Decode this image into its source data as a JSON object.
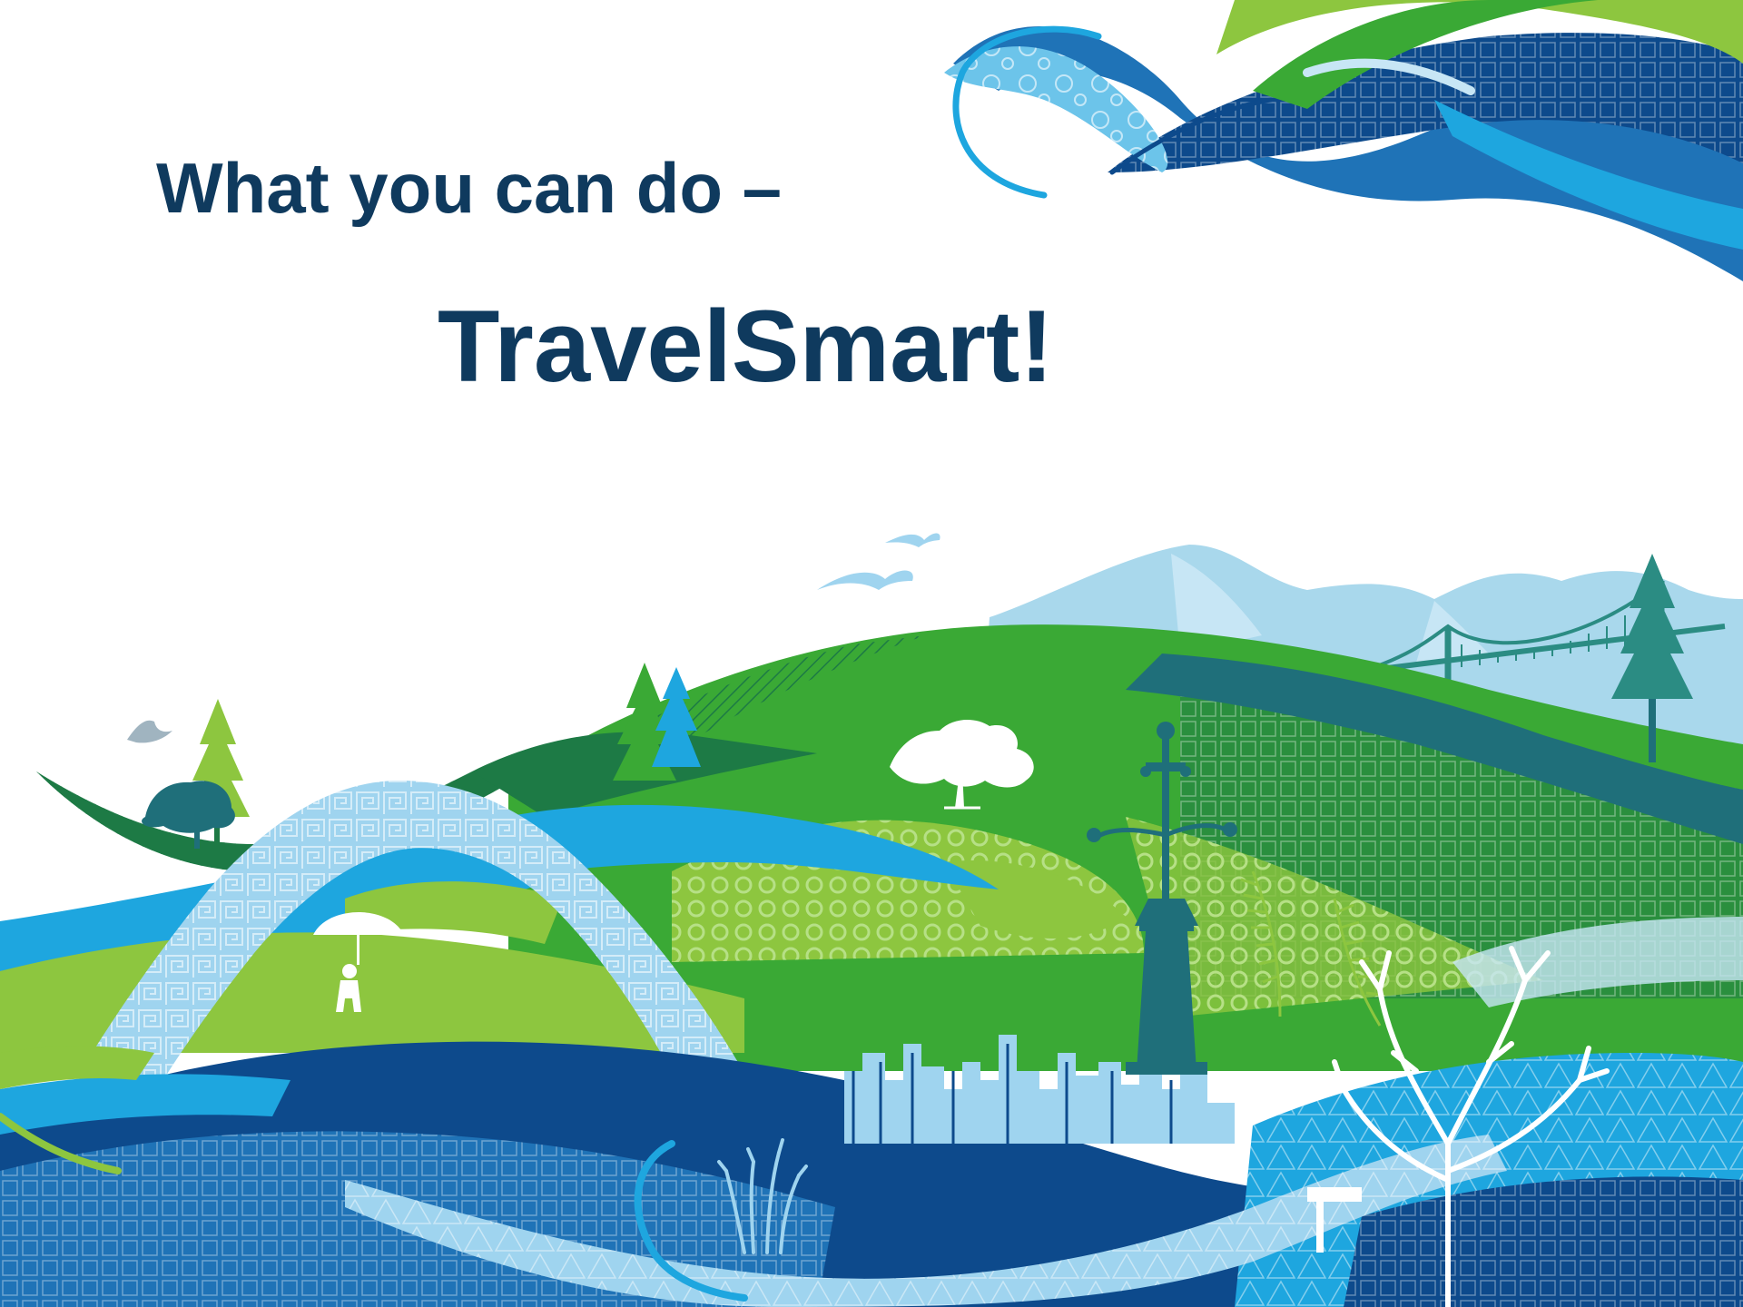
{
  "slide": {
    "heading": "What you can do –",
    "title": "TravelSmart!"
  },
  "colors": {
    "text": "#0f3a5e",
    "navy": "#0d4a8c",
    "blue": "#1f73b7",
    "cyan": "#1ea6df",
    "sky": "#9fd4ef",
    "pale_blue": "#c7e6f5",
    "lime": "#8dc63f",
    "green": "#3aa935",
    "dark_green": "#1d7a45",
    "teal": "#1f6f7a",
    "mountain": "#a9d8ec"
  },
  "icons": [
    "trees-icon",
    "birds-icon",
    "mountains-icon",
    "suspension-bridge-icon",
    "lamp-post-icon",
    "lighthouse-icon",
    "umbrella-figure-icon",
    "city-skyline-icon",
    "bare-tree-icon",
    "reeds-icon",
    "windswept-tree-icon"
  ]
}
